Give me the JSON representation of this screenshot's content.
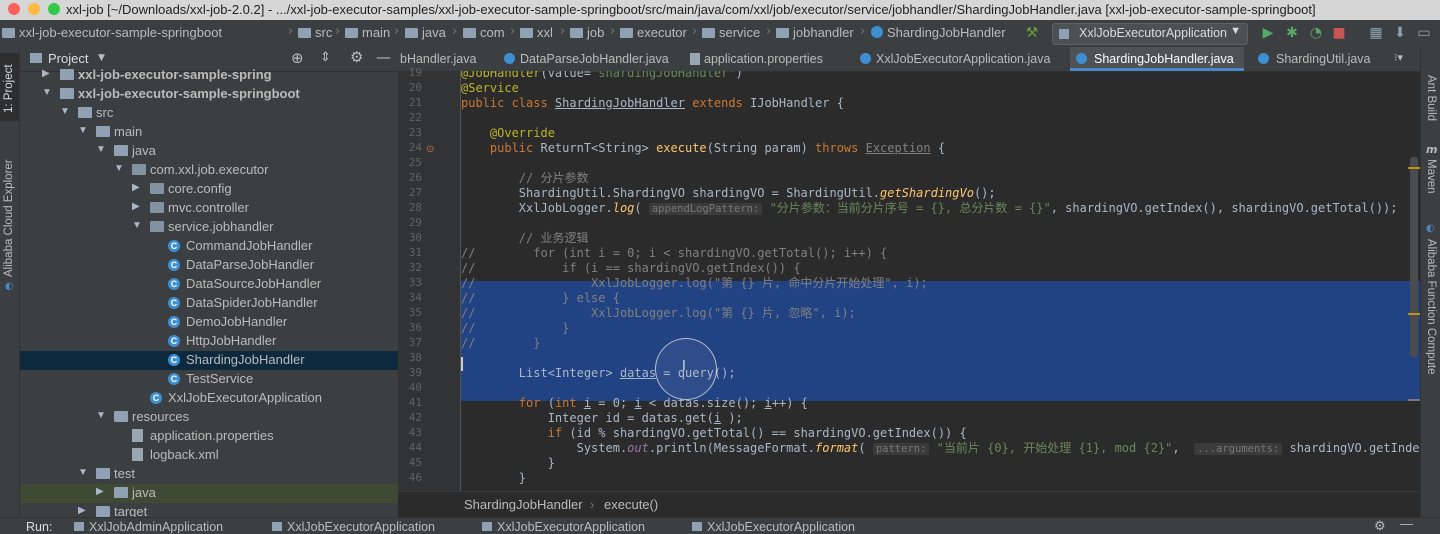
{
  "window": {
    "title": "xxl-job [~/Downloads/xxl-job-2.0.2] - .../xxl-job-executor-samples/xxl-job-executor-sample-springboot/src/main/java/com/xxl/job/executor/service/jobhandler/ShardingJobHandler.java [xxl-job-executor-sample-springboot]"
  },
  "breadcrumb": [
    "xxl-job-executor-sample-springboot",
    "src",
    "main",
    "java",
    "com",
    "xxl",
    "job",
    "executor",
    "service",
    "jobhandler",
    "ShardingJobHandler"
  ],
  "run_config": "XxlJobExecutorApplication",
  "left_strip": {
    "project": "1: Project",
    "alibaba": "Alibaba Cloud Explorer"
  },
  "project_panel": {
    "title": "Project",
    "tree": [
      {
        "label": "xxl-job-executor-sample-spring",
        "depth": 0,
        "arrow": "▶",
        "kind": "module"
      },
      {
        "label": "xxl-job-executor-sample-springboot",
        "depth": 0,
        "arrow": "▼",
        "kind": "module"
      },
      {
        "label": "src",
        "depth": 1,
        "arrow": "▼",
        "kind": "folder"
      },
      {
        "label": "main",
        "depth": 2,
        "arrow": "▼",
        "kind": "folder"
      },
      {
        "label": "java",
        "depth": 3,
        "arrow": "▼",
        "kind": "folder"
      },
      {
        "label": "com.xxl.job.executor",
        "depth": 4,
        "arrow": "▼",
        "kind": "package"
      },
      {
        "label": "core.config",
        "depth": 5,
        "arrow": "▶",
        "kind": "package"
      },
      {
        "label": "mvc.controller",
        "depth": 5,
        "arrow": "▶",
        "kind": "package"
      },
      {
        "label": "service.jobhandler",
        "depth": 5,
        "arrow": "▼",
        "kind": "package"
      },
      {
        "label": "CommandJobHandler",
        "depth": 6,
        "arrow": "",
        "kind": "class"
      },
      {
        "label": "DataParseJobHandler",
        "depth": 6,
        "arrow": "",
        "kind": "class"
      },
      {
        "label": "DataSourceJobHandler",
        "depth": 6,
        "arrow": "",
        "kind": "class"
      },
      {
        "label": "DataSpiderJobHandler",
        "depth": 6,
        "arrow": "",
        "kind": "class"
      },
      {
        "label": "DemoJobHandler",
        "depth": 6,
        "arrow": "",
        "kind": "class"
      },
      {
        "label": "HttpJobHandler",
        "depth": 6,
        "arrow": "",
        "kind": "class"
      },
      {
        "label": "ShardingJobHandler",
        "depth": 6,
        "arrow": "",
        "kind": "class",
        "selected": true
      },
      {
        "label": "TestService",
        "depth": 6,
        "arrow": "",
        "kind": "class"
      },
      {
        "label": "XxlJobExecutorApplication",
        "depth": 5,
        "arrow": "",
        "kind": "class"
      },
      {
        "label": "resources",
        "depth": 3,
        "arrow": "▼",
        "kind": "folder"
      },
      {
        "label": "application.properties",
        "depth": 4,
        "arrow": "",
        "kind": "file"
      },
      {
        "label": "logback.xml",
        "depth": 4,
        "arrow": "",
        "kind": "file"
      },
      {
        "label": "test",
        "depth": 2,
        "arrow": "▼",
        "kind": "folder"
      },
      {
        "label": "java",
        "depth": 3,
        "arrow": "▶",
        "kind": "folder",
        "highlight": true
      },
      {
        "label": "target",
        "depth": 2,
        "arrow": "▶",
        "kind": "folder"
      }
    ]
  },
  "editor_tabs": [
    {
      "label": "bHandler.java",
      "active": false
    },
    {
      "label": "DataParseJobHandler.java",
      "active": false
    },
    {
      "label": "application.properties",
      "active": false
    },
    {
      "label": "XxlJobExecutorApplication.java",
      "active": false
    },
    {
      "label": "ShardingJobHandler.java",
      "active": true
    },
    {
      "label": "ShardingUtil.java",
      "active": false
    }
  ],
  "code": {
    "line_numbers": [
      "19",
      "20",
      "21",
      "22",
      "23",
      "24",
      "25",
      "26",
      "27",
      "28",
      "29",
      "30",
      "31",
      "32",
      "33",
      "34",
      "35",
      "36",
      "37",
      "38",
      "39",
      "40",
      "41",
      "42",
      "43",
      "44",
      "45",
      "46"
    ],
    "lines": [
      [
        [
          "ann",
          "@JobHandler"
        ],
        [
          "",
          "(value="
        ],
        [
          "str",
          "\"shardingJobHandler\""
        ],
        [
          "",
          ")"
        ]
      ],
      [
        [
          "ann",
          "@Service"
        ]
      ],
      [
        [
          "kw",
          "public class "
        ],
        [
          "und",
          "ShardingJobHandler"
        ],
        [
          "kw",
          " extends "
        ],
        [
          "",
          "IJobHandler {"
        ]
      ],
      [],
      [
        [
          "ann",
          "    @Override"
        ]
      ],
      [
        [
          "kw",
          "    public "
        ],
        [
          "",
          "ReturnT<String> "
        ],
        [
          "fn",
          "execute"
        ],
        [
          "",
          "(String param) "
        ],
        [
          "kw",
          "throws "
        ],
        [
          "und cmt",
          "Exception"
        ],
        [
          "",
          " {"
        ]
      ],
      [],
      [
        [
          "cmt",
          "        // 分片参数"
        ]
      ],
      [
        [
          "",
          "        ShardingUtil.ShardingVO shardingVO = ShardingUtil."
        ],
        [
          "fn it",
          "getShardingVo"
        ],
        [
          "",
          "();"
        ]
      ],
      [
        [
          "",
          "        XxlJobLogger."
        ],
        [
          "fn it",
          "log"
        ],
        [
          "",
          "( "
        ],
        [
          "hint",
          "appendLogPattern:"
        ],
        [
          "",
          " "
        ],
        [
          "str",
          "\"分片参数：当前分片序号 = {}, 总分片数 = {}\""
        ],
        [
          "",
          ", shardingVO.getIndex(), shardingVO.getTotal());"
        ]
      ],
      [],
      [
        [
          "cmt",
          "        // 业务逻辑"
        ]
      ],
      [
        [
          "cmt",
          "//        for (int i = 0; i < shardingVO.getTotal(); i++) {"
        ]
      ],
      [
        [
          "cmt",
          "//            if (i == shardingVO.getIndex()) {"
        ]
      ],
      [
        [
          "cmt",
          "//                XxlJobLogger.log(\"第 {} 片, 命中分片开始处理\", i);"
        ]
      ],
      [
        [
          "cmt",
          "//            } else {"
        ]
      ],
      [
        [
          "cmt",
          "//                XxlJobLogger.log(\"第 {} 片, 忽略\", i);"
        ]
      ],
      [
        [
          "cmt",
          "//            }"
        ]
      ],
      [
        [
          "cmt",
          "//        }"
        ]
      ],
      [],
      [
        [
          "",
          "        List<Integer> "
        ],
        [
          "und",
          "datas"
        ],
        [
          "",
          " = query();"
        ]
      ],
      [],
      [
        [
          "kw",
          "        for "
        ],
        [
          "",
          "("
        ],
        [
          "kw",
          "int "
        ],
        [
          "und",
          "i"
        ],
        [
          "",
          " = "
        ],
        [
          "",
          "0; "
        ],
        [
          "und",
          "i"
        ],
        [
          "",
          " < datas.size(); "
        ],
        [
          "und",
          "i"
        ],
        [
          "",
          "++) {"
        ]
      ],
      [
        [
          "",
          "            Integer id = datas.get("
        ],
        [
          "und",
          "i"
        ],
        [
          "",
          " );"
        ]
      ],
      [
        [
          "kw",
          "            if "
        ],
        [
          "",
          "(id % shardingVO.getTotal() == shardingVO.getIndex()) {"
        ]
      ],
      [
        [
          "",
          "                System."
        ],
        [
          "stat",
          "out"
        ],
        [
          "",
          ".println(MessageFormat."
        ],
        [
          "fn it",
          "format"
        ],
        [
          "",
          "( "
        ],
        [
          "hint",
          "pattern:"
        ],
        [
          "",
          " "
        ],
        [
          "str",
          "\"当前片 {0}, 开始处理 {1}, mod {2}\""
        ],
        [
          "",
          ",  "
        ],
        [
          "hint",
          "...arguments:"
        ],
        [
          "",
          " shardingVO.getIndex(), id,"
        ]
      ],
      [
        [
          "",
          "            }"
        ]
      ],
      [
        [
          "",
          "        }"
        ]
      ]
    ]
  },
  "editor_breadcrumb": [
    "ShardingJobHandler",
    "execute()"
  ],
  "right_strip": [
    "Ant Build",
    "Maven",
    "Alibaba Function Compute"
  ],
  "run_bar": {
    "label": "Run:",
    "tabs": [
      "XxlJobAdminApplication",
      "XxlJobExecutorApplication",
      "XxlJobExecutorApplication",
      "XxlJobExecutorApplication"
    ]
  }
}
